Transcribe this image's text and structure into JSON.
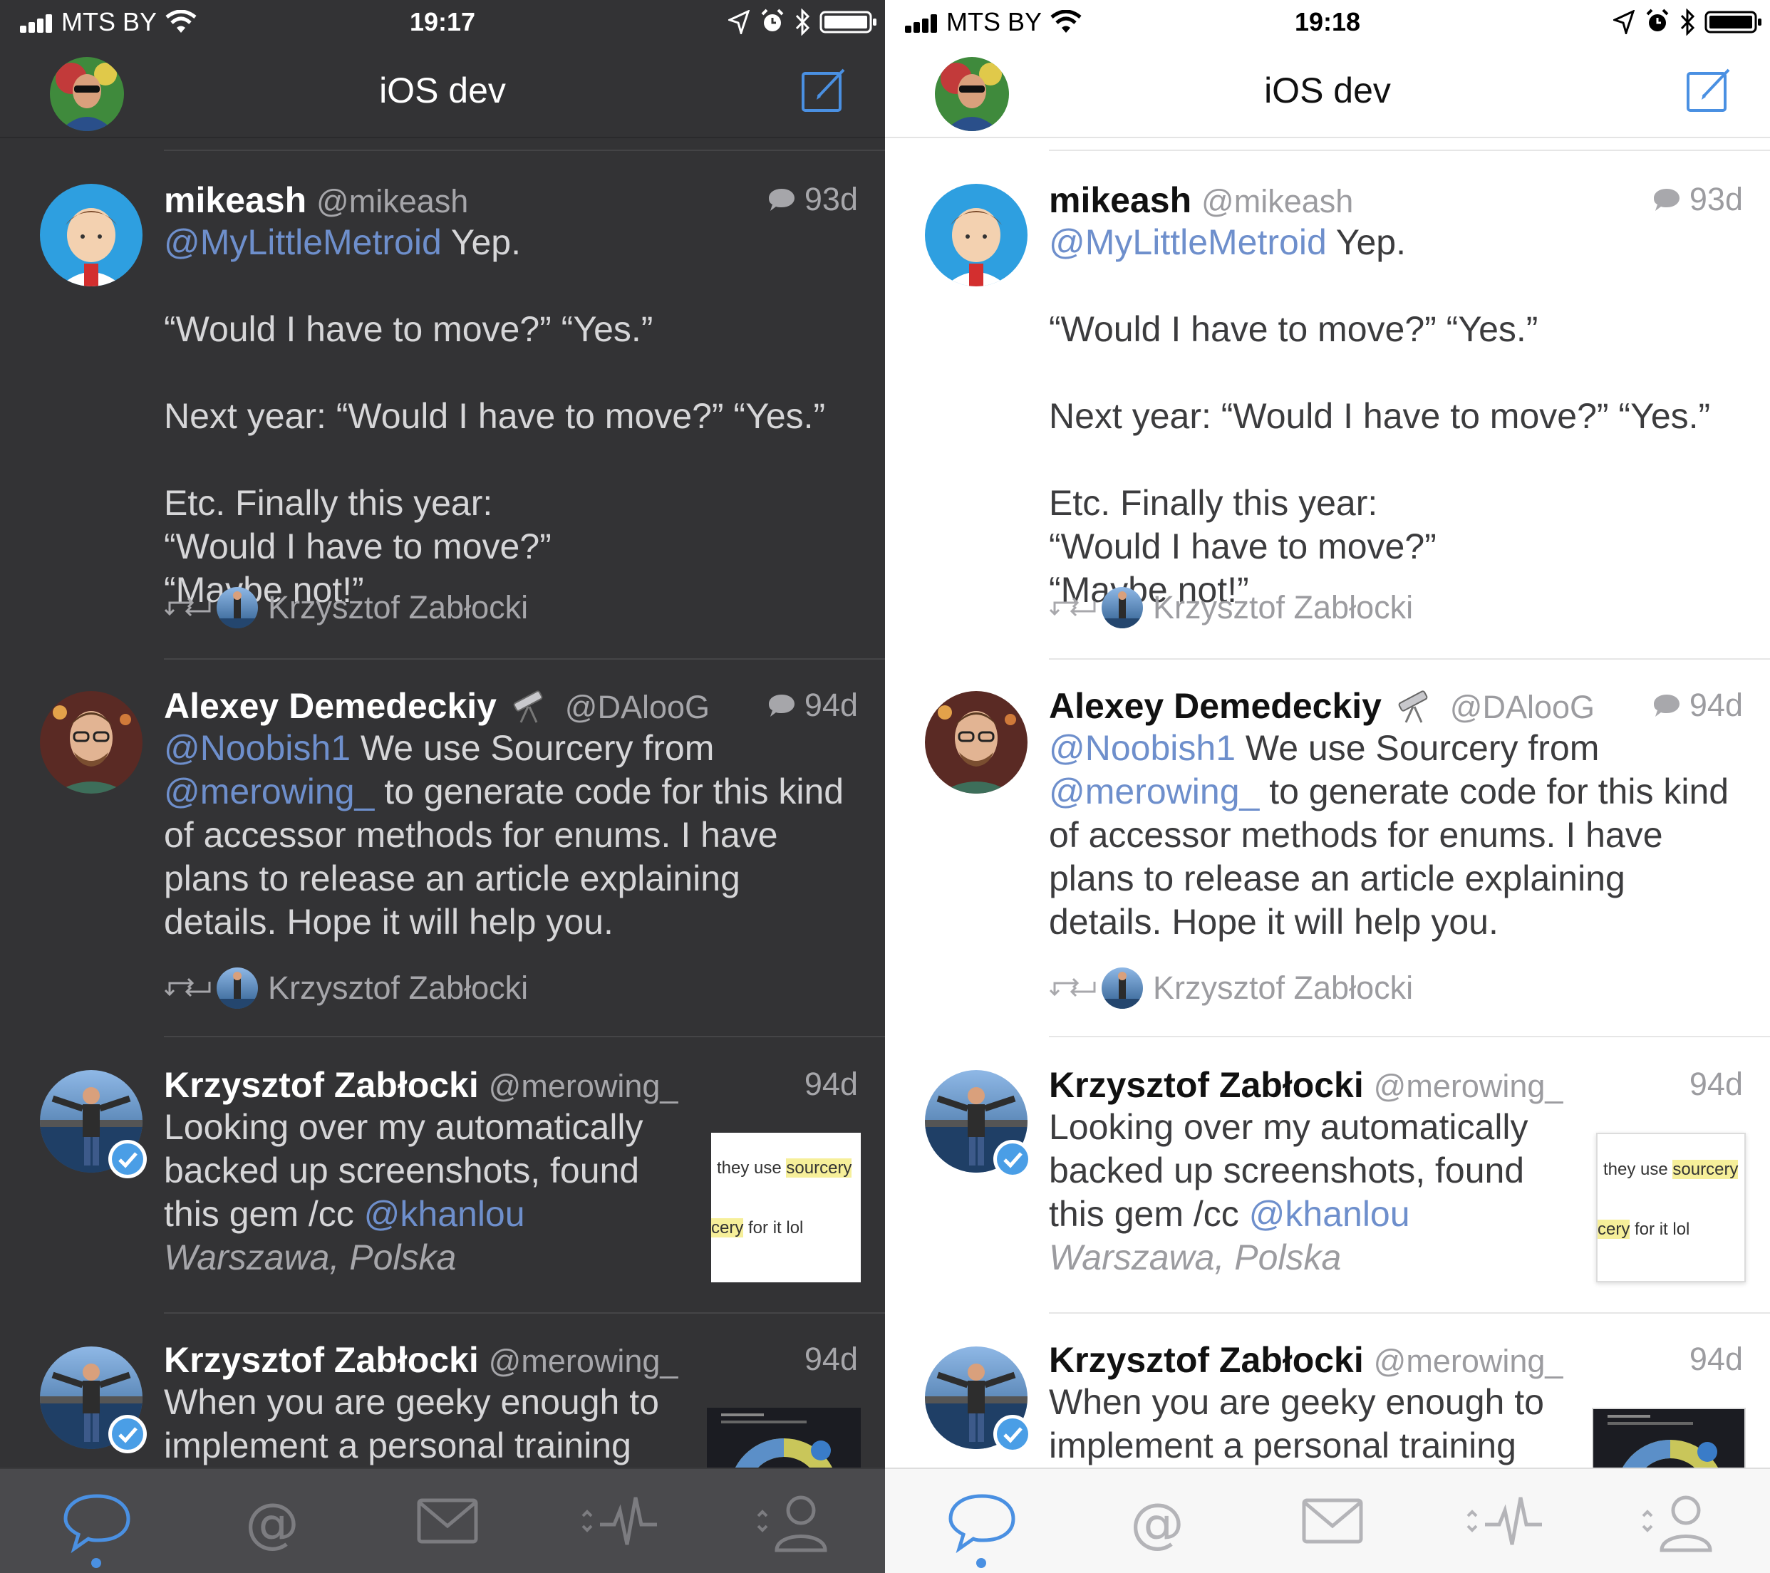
{
  "colors": {
    "accent": "#4a90e2",
    "mention": "#6e8fcc",
    "dark_bg": "#333335",
    "light_bg": "#ffffff"
  },
  "phones": {
    "dark": {
      "status": {
        "carrier": "MTS BY",
        "time": "19:17"
      },
      "nav": {
        "title": "iOS dev"
      }
    },
    "light": {
      "status": {
        "carrier": "MTS BY",
        "time": "19:18"
      },
      "nav": {
        "title": "iOS dev"
      }
    }
  },
  "feed": [
    {
      "name": "mikeash",
      "handle": "@mikeash",
      "age": "93d",
      "mention1": "@MyLittleMetroid",
      "text1": " Yep.",
      "line2": "“Would I have to move?” “Yes.”",
      "line3": "Next year: “Would I have to move?” “Yes.”",
      "line4": "Etc. Finally this year: “Would I have to move?” “Maybe not!”",
      "retweeted_by": "Krzysztof Zabłocki"
    },
    {
      "name": "Alexey Demedeckiy",
      "handle": "@DAlooG",
      "age": "94d",
      "mention1": "@Noobish1",
      "text1": " We use Sourcery from ",
      "mention2": "@merowing_",
      "text2": " to generate code for this kind of accessor methods for enums. I have plans to release an article explaining details. Hope it will help you.",
      "retweeted_by": "Krzysztof Zabłocki"
    },
    {
      "name": "Krzysztof Zabłocki",
      "handle": "@merowing_",
      "age": "94d",
      "text1": "Looking over my automatically backed up screenshots, found this gem /cc ",
      "mention1": "@khanlou",
      "location": "Warszawa, Polska",
      "thumb": {
        "line1_a": "they use ",
        "line1_b": "sourcery",
        "line2_a": "cery",
        "line2_b": " for it lol"
      }
    },
    {
      "name": "Krzysztof Zabłocki",
      "handle": "@merowing_",
      "age": "94d",
      "text1": "When you are geeky enough to implement a personal training"
    }
  ],
  "tabs": [
    "timeline-icon",
    "mentions-icon",
    "messages-icon",
    "activity-icon",
    "profile-icon"
  ]
}
